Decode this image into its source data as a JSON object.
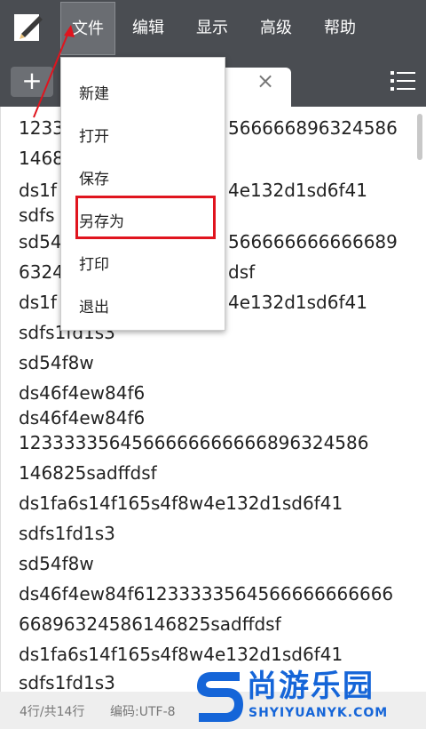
{
  "menubar": {
    "items": [
      {
        "label": "文件"
      },
      {
        "label": "编辑"
      },
      {
        "label": "显示"
      },
      {
        "label": "高级"
      },
      {
        "label": "帮助"
      }
    ]
  },
  "tabbar": {
    "add_symbol": "+",
    "close_symbol": "×"
  },
  "editor": {
    "lines": [
      "1233",
      "566666896324586",
      "1468",
      "ds1f",
      "4e132d1sd6f41",
      "sdfs",
      "sd54",
      "566666666666689",
      "6324",
      "dsf",
      "ds1f",
      "4e132d1sd6f41",
      "sdfs1fd1s3",
      "sd54f8w",
      "ds46f4ew84f6",
      "ds46f4ew84f6",
      "1233333564566666666666896324586",
      "146825sadffdsf",
      "ds1fa6s14f165s4f8w4e132d1sd6f41",
      "sdfs1fd1s3",
      "sd54f8w",
      "ds46f4ew84f61233333564566666666666",
      "66896324586146825sadffdsf",
      "ds1fa6s14f165s4f8w4e132d1sd6f41",
      "sdfs1fd1s3"
    ]
  },
  "dropdown": {
    "items": [
      {
        "label": "新建"
      },
      {
        "label": "打开"
      },
      {
        "label": "保存"
      },
      {
        "label": "另存为"
      },
      {
        "label": "打印"
      },
      {
        "label": "退出"
      }
    ],
    "highlighted": "另存为"
  },
  "statusbar": {
    "position": "4行/共14行",
    "encoding": "编码:UTF-8"
  },
  "watermark": {
    "logo_letter": "S",
    "title": "尚游乐园",
    "url": "SHYIYUANYK.COM"
  },
  "colors": {
    "menubar_bg": "#4a4d52",
    "highlight_border": "#e0141e",
    "watermark_blue": "#1565d8"
  }
}
